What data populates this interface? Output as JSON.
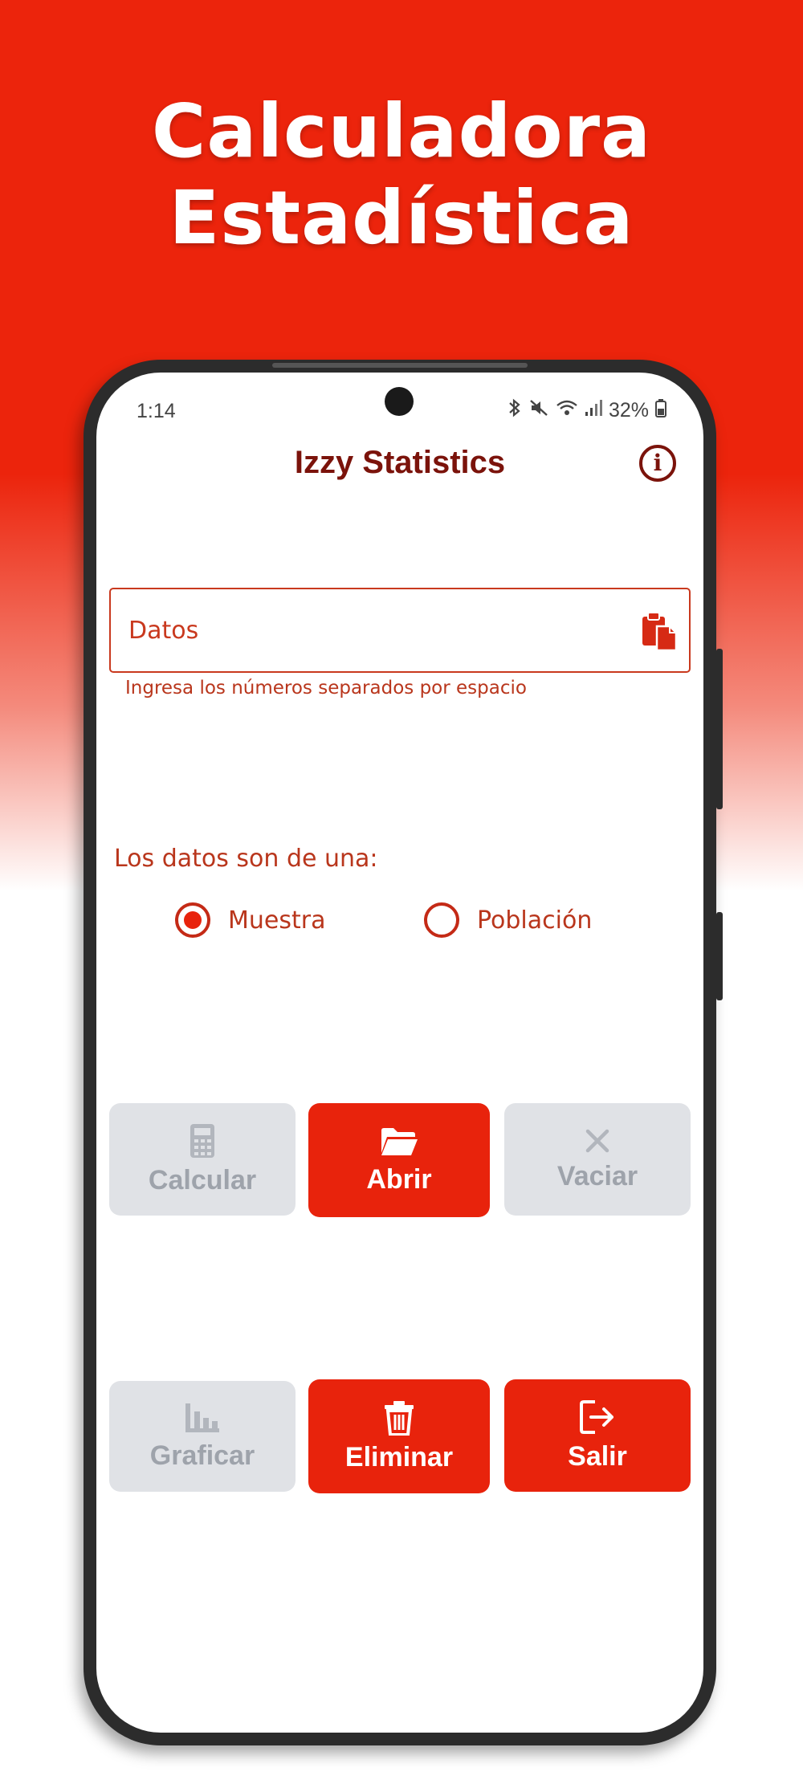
{
  "promo": {
    "line1": "Calculadora",
    "line2": "Estadística"
  },
  "status_bar": {
    "time": "1:14",
    "battery": "32%"
  },
  "app_bar": {
    "title": "Izzy Statistics",
    "info_icon": "info-icon"
  },
  "data_field": {
    "placeholder": "Datos",
    "value": "",
    "helper": "Ingresa los números separados por espacio",
    "paste_icon": "clipboard-paste-icon"
  },
  "data_type": {
    "label": "Los datos son de una:",
    "options": [
      {
        "label": "Muestra",
        "selected": true
      },
      {
        "label": "Población",
        "selected": false
      }
    ]
  },
  "buttons": {
    "row1": [
      {
        "label": "Calcular",
        "icon": "calculator-icon",
        "enabled": false
      },
      {
        "label": "Abrir",
        "icon": "folder-open-icon",
        "enabled": true
      },
      {
        "label": "Vaciar",
        "icon": "close-icon",
        "enabled": false
      }
    ],
    "row2": [
      {
        "label": "Graficar",
        "icon": "bar-chart-icon",
        "enabled": false
      },
      {
        "label": "Eliminar",
        "icon": "trash-icon",
        "enabled": true
      },
      {
        "label": "Salir",
        "icon": "logout-icon",
        "enabled": true
      }
    ]
  },
  "colors": {
    "brand_red": "#e8230c",
    "title_dark_red": "#7b130b",
    "disabled_bg": "#e0e2e6",
    "disabled_text": "#9ea3ab"
  }
}
